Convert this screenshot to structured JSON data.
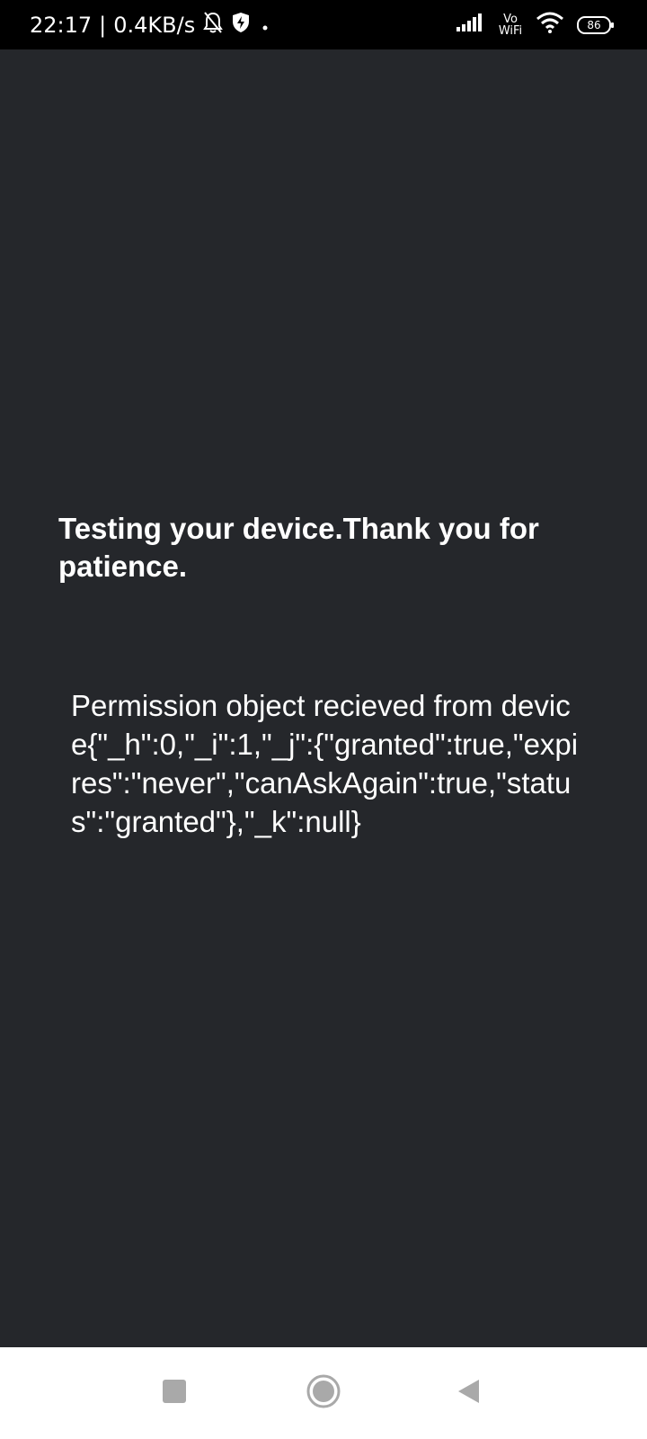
{
  "status_bar": {
    "time": "22:17",
    "separator": "|",
    "net_speed": "0.4KB/s",
    "volte_top": "Vo",
    "volte_bottom": "WiFi",
    "battery_level": "86",
    "icons": [
      "bell-off-icon",
      "shield-icon",
      "dot-icon",
      "signal-icon",
      "wifi-icon",
      "battery-icon"
    ]
  },
  "main": {
    "heading": "Testing your device.Thank you for patience.",
    "permission_message": "Permission object recieved from device{\"_h\":0,\"_i\":1,\"_j\":{\"granted\":true,\"expires\":\"never\",\"canAskAgain\":true,\"status\":\"granted\"},\"_k\":null}"
  },
  "nav_bar": {
    "buttons": [
      "recents-icon",
      "home-icon",
      "back-icon"
    ]
  },
  "colors": {
    "background": "#25272b",
    "status_bar": "#000000",
    "nav_bar": "#ffffff",
    "nav_icons": "#a9a9a9",
    "text": "#ffffff"
  }
}
